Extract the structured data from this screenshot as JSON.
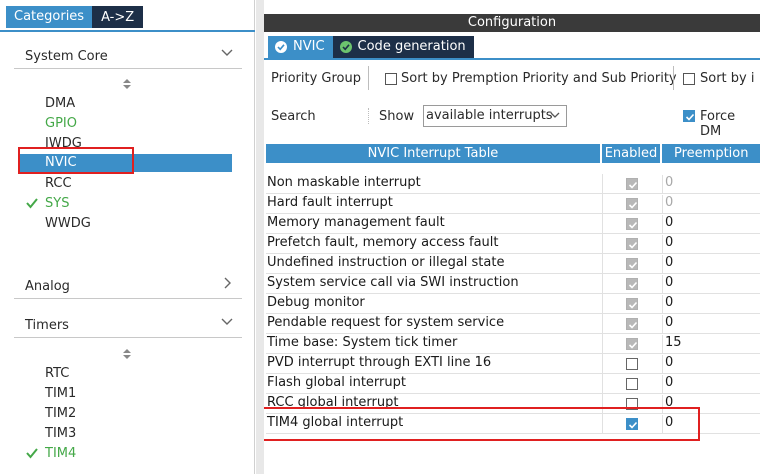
{
  "left": {
    "tabs": [
      {
        "label": "Categories",
        "active": true
      },
      {
        "label": "A->Z",
        "active": false
      }
    ],
    "sections": [
      {
        "label": "System Core",
        "expanded": true,
        "items": [
          {
            "label": "DMA",
            "status": "normal"
          },
          {
            "label": "GPIO",
            "status": "green"
          },
          {
            "label": "IWDG",
            "status": "normal"
          },
          {
            "label": "NVIC",
            "status": "selected"
          },
          {
            "label": "RCC",
            "status": "normal"
          },
          {
            "label": "SYS",
            "status": "checked"
          },
          {
            "label": "WWDG",
            "status": "normal"
          }
        ]
      },
      {
        "label": "Analog",
        "expanded": false,
        "items": []
      },
      {
        "label": "Timers",
        "expanded": true,
        "items": [
          {
            "label": "RTC",
            "status": "normal"
          },
          {
            "label": "TIM1",
            "status": "normal"
          },
          {
            "label": "TIM2",
            "status": "normal"
          },
          {
            "label": "TIM3",
            "status": "normal"
          },
          {
            "label": "TIM4",
            "status": "checked"
          }
        ]
      }
    ]
  },
  "config": {
    "title": "Configuration",
    "tabs": [
      {
        "label": "NVIC",
        "active": true,
        "icon": "check-circle-icon"
      },
      {
        "label": "Code generation",
        "active": false,
        "icon": "check-circle-icon"
      }
    ],
    "priority_group_label": "Priority Group",
    "sort_preemption_label": "Sort by Premption Priority and Sub Priority",
    "sort_by_i_label": "Sort by i",
    "search_label": "Search",
    "show_label": "Show",
    "show_value": "available interrupts",
    "force_label": "Force DM",
    "table": {
      "headers": [
        "NVIC Interrupt Table",
        "Enabled",
        "Preemption"
      ],
      "rows": [
        {
          "name": "Non maskable interrupt",
          "enabled": "locked",
          "priority": "0",
          "muted": true
        },
        {
          "name": "Hard fault interrupt",
          "enabled": "locked",
          "priority": "0",
          "muted": true
        },
        {
          "name": "Memory management fault",
          "enabled": "locked",
          "priority": "0",
          "muted": false
        },
        {
          "name": "Prefetch fault, memory access fault",
          "enabled": "locked",
          "priority": "0",
          "muted": false
        },
        {
          "name": "Undefined instruction or illegal state",
          "enabled": "locked",
          "priority": "0",
          "muted": false
        },
        {
          "name": "System service call via SWI instruction",
          "enabled": "locked",
          "priority": "0",
          "muted": false
        },
        {
          "name": "Debug monitor",
          "enabled": "locked",
          "priority": "0",
          "muted": false
        },
        {
          "name": "Pendable request for system service",
          "enabled": "locked",
          "priority": "0",
          "muted": false
        },
        {
          "name": "Time base: System tick timer",
          "enabled": "locked",
          "priority": "15",
          "muted": false
        },
        {
          "name": "PVD interrupt through EXTI line 16",
          "enabled": "off",
          "priority": "0",
          "muted": false
        },
        {
          "name": "Flash global interrupt",
          "enabled": "off",
          "priority": "0",
          "muted": false
        },
        {
          "name": "RCC global interrupt",
          "enabled": "off",
          "priority": "0",
          "muted": false
        },
        {
          "name": "TIM4 global interrupt",
          "enabled": "on",
          "priority": "0",
          "muted": false
        }
      ]
    }
  },
  "colors": {
    "accent": "#3c8fc8",
    "dark_tab": "#1d2f48",
    "config_bar": "#3a3a3a",
    "green": "#44a848",
    "highlight": "#e02020"
  }
}
